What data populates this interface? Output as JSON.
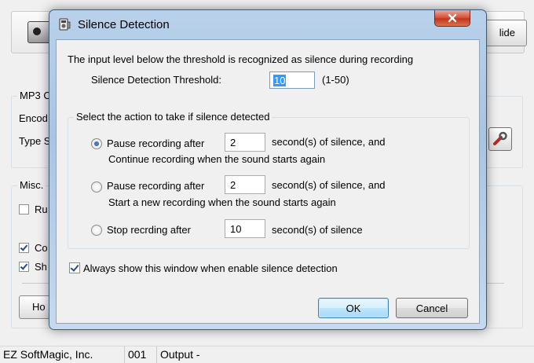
{
  "background": {
    "toolbar_right_button": "lide",
    "group1_label": "MP3 C",
    "encoding_label": "Encod",
    "type_label": "Type S",
    "group2_label": "Misc.",
    "check1_label": "Ru",
    "check2_label": "Co",
    "check3_label": "Sh",
    "hot_button": "Ho"
  },
  "dialog": {
    "title": "Silence Detection",
    "intro_text": "The input level below the threshold is recognized as silence during recording",
    "threshold_label": "Silence Detection Threshold:",
    "threshold_value": "10",
    "threshold_range": "(1-50)",
    "group_label": "Select the action to take if silence detected",
    "options": [
      {
        "label": "Pause recording after",
        "value": "2",
        "suffix": "second(s) of silence, and",
        "detail": "Continue recording when the sound starts again",
        "selected": true
      },
      {
        "label": "Pause recording after",
        "value": "2",
        "suffix": "second(s) of silence, and",
        "detail": "Start a new recording when the sound starts again",
        "selected": false
      },
      {
        "label": "Stop recrding after",
        "value": "10",
        "suffix": "second(s) of silence",
        "selected": false
      }
    ],
    "always_show_label": "Always show this window when enable silence detection",
    "always_show_checked": true,
    "ok_label": "OK",
    "cancel_label": "Cancel"
  },
  "status_bar": {
    "company": "EZ SoftMagic, Inc.",
    "code": "001",
    "output": "Output -"
  }
}
